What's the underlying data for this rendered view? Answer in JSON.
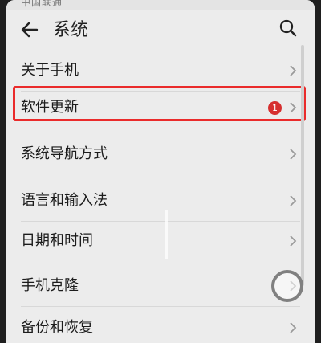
{
  "status_bar": {
    "carrier": "中国联通"
  },
  "header": {
    "title": "系统"
  },
  "menu": {
    "items": [
      {
        "label": "关于手机"
      },
      {
        "label": "软件更新",
        "badge": "1"
      },
      {
        "label": "系统导航方式"
      },
      {
        "label": "语言和输入法"
      },
      {
        "label": "日期和时间"
      },
      {
        "label": "手机克隆"
      },
      {
        "label": "备份和恢复"
      }
    ]
  },
  "colors": {
    "highlight": "#ea2b2b",
    "badge": "#d62f2f",
    "background": "#ececec"
  },
  "icons": {
    "back": "back-arrow-icon",
    "search": "search-icon",
    "chevron": "chevron-right-icon",
    "floating": "floating-assist-ball"
  }
}
